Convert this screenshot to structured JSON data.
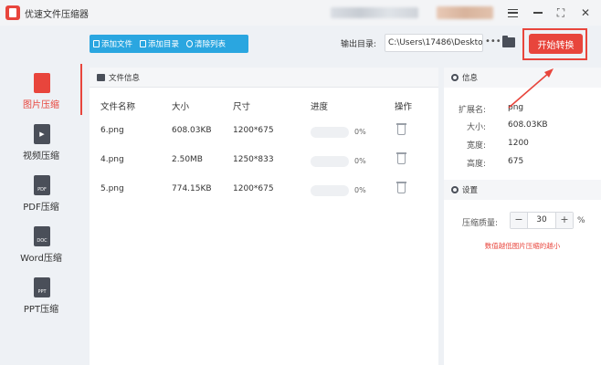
{
  "app": {
    "title": "优速文件压缩器"
  },
  "sidebar": {
    "items": [
      {
        "label": "图片压缩",
        "icon": "image-file-icon",
        "active": true
      },
      {
        "label": "视频压缩",
        "icon": "video-file-icon",
        "active": false
      },
      {
        "label": "PDF压缩",
        "icon": "pdf-file-icon",
        "badge": "PDF",
        "active": false
      },
      {
        "label": "Word压缩",
        "icon": "doc-file-icon",
        "badge": "DOC",
        "active": false
      },
      {
        "label": "PPT压缩",
        "icon": "ppt-file-icon",
        "badge": "PPT",
        "active": false
      }
    ]
  },
  "toolbar": {
    "add_file": "添加文件",
    "add_folder": "添加目录",
    "clear_list": "清除列表",
    "output_label": "输出目录:",
    "output_path": "C:\\Users\\17486\\Deskto",
    "more_label": "•••",
    "start_label": "开始转换"
  },
  "file_panel": {
    "title": "文件信息",
    "columns": [
      "文件名称",
      "大小",
      "尺寸",
      "进度",
      "操作"
    ],
    "rows": [
      {
        "name": "6.png",
        "size": "608.03KB",
        "dims": "1200*675",
        "progress": 0,
        "progress_text": "0%"
      },
      {
        "name": "4.png",
        "size": "2.50MB",
        "dims": "1250*833",
        "progress": 0,
        "progress_text": "0%"
      },
      {
        "name": "5.png",
        "size": "774.15KB",
        "dims": "1200*675",
        "progress": 0,
        "progress_text": "0%"
      }
    ]
  },
  "info_panel": {
    "title": "信息",
    "fields": [
      {
        "key": "扩展名:",
        "value": "png"
      },
      {
        "key": "大小:",
        "value": "608.03KB"
      },
      {
        "key": "宽度:",
        "value": "1200"
      },
      {
        "key": "高度:",
        "value": "675"
      }
    ]
  },
  "settings": {
    "title": "设置",
    "quality_label": "压缩质量:",
    "quality_value": "30",
    "minus": "−",
    "plus": "+",
    "unit": "%",
    "hint": "数值越低图片压缩的越小"
  },
  "colors": {
    "accent": "#e8453c",
    "toolbar": "#2aa6e0"
  }
}
